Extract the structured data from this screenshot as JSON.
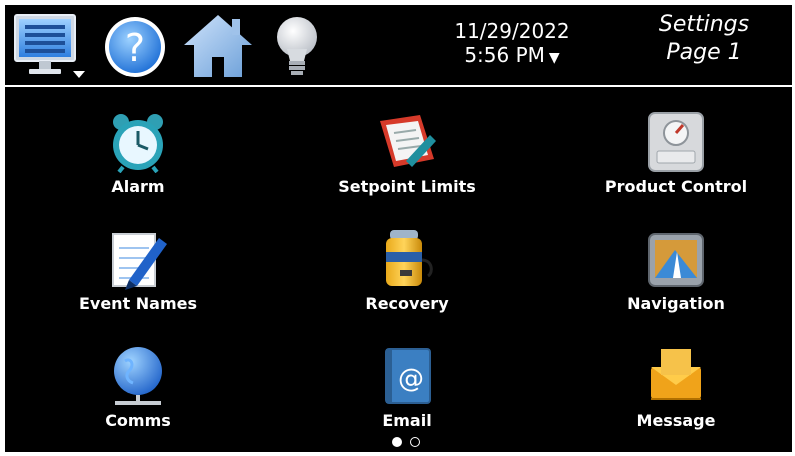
{
  "header": {
    "date": "11/29/2022",
    "time": "5:56 PM",
    "time_dropdown_glyph": "▼",
    "title_line1": "Settings",
    "title_line2": "Page 1"
  },
  "toolbar": {
    "icons": [
      "monitor-menu-icon",
      "help-icon",
      "home-icon",
      "lightbulb-icon"
    ]
  },
  "settings_items": [
    {
      "label": "Alarm",
      "icon": "alarm-clock-icon"
    },
    {
      "label": "Setpoint Limits",
      "icon": "setpoint-limits-icon"
    },
    {
      "label": "Product Control",
      "icon": "product-control-icon"
    },
    {
      "label": "Event Names",
      "icon": "notepad-pen-icon"
    },
    {
      "label": "Recovery",
      "icon": "battery-icon"
    },
    {
      "label": "Navigation",
      "icon": "gps-navigation-icon"
    },
    {
      "label": "Comms",
      "icon": "globe-network-icon"
    },
    {
      "label": "Email",
      "icon": "email-book-icon"
    },
    {
      "label": "Message",
      "icon": "envelope-inbox-icon"
    }
  ],
  "pager": {
    "current_page": 1,
    "total_pages": 2
  },
  "colors": {
    "background": "#000000",
    "text": "#ffffff",
    "accent_blue": "#2f7fe0"
  }
}
